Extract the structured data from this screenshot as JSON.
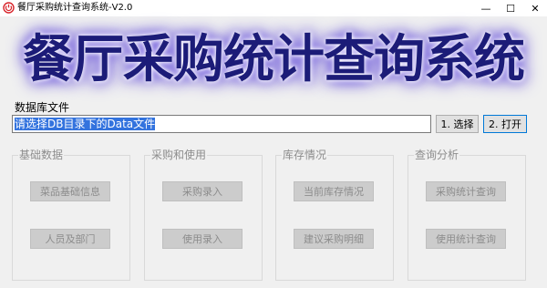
{
  "window": {
    "title": "餐厅采购统计查询系统-V2.0",
    "minimize": "—",
    "maximize": "☐",
    "close": "✕",
    "app_icon": "power-icon"
  },
  "banner": {
    "text": "餐厅采购统计查询系统"
  },
  "database": {
    "label": "数据库文件",
    "path_value": "请选择DB目录下的Data文件",
    "select_button": "1. 选择",
    "open_button": "2. 打开"
  },
  "groups": [
    {
      "title": "基础数据",
      "buttons": [
        "菜品基础信息",
        "人员及部门"
      ]
    },
    {
      "title": "采购和使用",
      "buttons": [
        "采购录入",
        "使用录入"
      ]
    },
    {
      "title": "库存情况",
      "buttons": [
        "当前库存情况",
        "建议采购明细"
      ]
    },
    {
      "title": "查询分析",
      "buttons": [
        "采购统计查询",
        "使用统计查询"
      ]
    }
  ],
  "colors": {
    "banner_text": "#1c1c78",
    "banner_glow": "#4d2fd9",
    "selection": "#3373de",
    "app_icon": "#d8262c"
  }
}
